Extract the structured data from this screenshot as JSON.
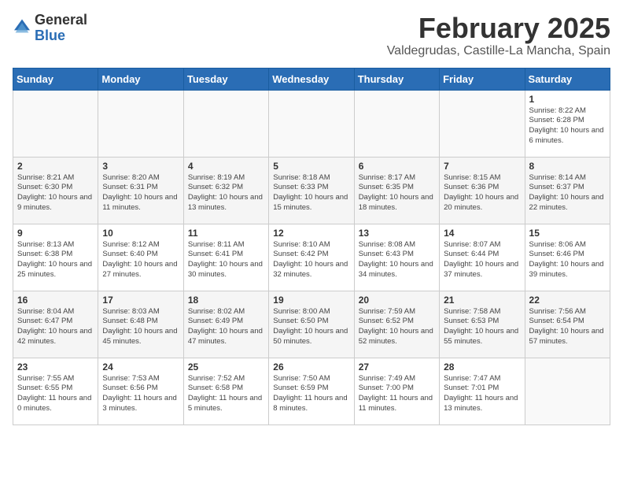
{
  "header": {
    "logo_general": "General",
    "logo_blue": "Blue",
    "month": "February 2025",
    "location": "Valdegrudas, Castille-La Mancha, Spain"
  },
  "days_of_week": [
    "Sunday",
    "Monday",
    "Tuesday",
    "Wednesday",
    "Thursday",
    "Friday",
    "Saturday"
  ],
  "weeks": [
    [
      {
        "day": "",
        "info": ""
      },
      {
        "day": "",
        "info": ""
      },
      {
        "day": "",
        "info": ""
      },
      {
        "day": "",
        "info": ""
      },
      {
        "day": "",
        "info": ""
      },
      {
        "day": "",
        "info": ""
      },
      {
        "day": "1",
        "info": "Sunrise: 8:22 AM\nSunset: 6:28 PM\nDaylight: 10 hours\nand 6 minutes."
      }
    ],
    [
      {
        "day": "2",
        "info": "Sunrise: 8:21 AM\nSunset: 6:30 PM\nDaylight: 10 hours\nand 9 minutes."
      },
      {
        "day": "3",
        "info": "Sunrise: 8:20 AM\nSunset: 6:31 PM\nDaylight: 10 hours\nand 11 minutes."
      },
      {
        "day": "4",
        "info": "Sunrise: 8:19 AM\nSunset: 6:32 PM\nDaylight: 10 hours\nand 13 minutes."
      },
      {
        "day": "5",
        "info": "Sunrise: 8:18 AM\nSunset: 6:33 PM\nDaylight: 10 hours\nand 15 minutes."
      },
      {
        "day": "6",
        "info": "Sunrise: 8:17 AM\nSunset: 6:35 PM\nDaylight: 10 hours\nand 18 minutes."
      },
      {
        "day": "7",
        "info": "Sunrise: 8:15 AM\nSunset: 6:36 PM\nDaylight: 10 hours\nand 20 minutes."
      },
      {
        "day": "8",
        "info": "Sunrise: 8:14 AM\nSunset: 6:37 PM\nDaylight: 10 hours\nand 22 minutes."
      }
    ],
    [
      {
        "day": "9",
        "info": "Sunrise: 8:13 AM\nSunset: 6:38 PM\nDaylight: 10 hours\nand 25 minutes."
      },
      {
        "day": "10",
        "info": "Sunrise: 8:12 AM\nSunset: 6:40 PM\nDaylight: 10 hours\nand 27 minutes."
      },
      {
        "day": "11",
        "info": "Sunrise: 8:11 AM\nSunset: 6:41 PM\nDaylight: 10 hours\nand 30 minutes."
      },
      {
        "day": "12",
        "info": "Sunrise: 8:10 AM\nSunset: 6:42 PM\nDaylight: 10 hours\nand 32 minutes."
      },
      {
        "day": "13",
        "info": "Sunrise: 8:08 AM\nSunset: 6:43 PM\nDaylight: 10 hours\nand 34 minutes."
      },
      {
        "day": "14",
        "info": "Sunrise: 8:07 AM\nSunset: 6:44 PM\nDaylight: 10 hours\nand 37 minutes."
      },
      {
        "day": "15",
        "info": "Sunrise: 8:06 AM\nSunset: 6:46 PM\nDaylight: 10 hours\nand 39 minutes."
      }
    ],
    [
      {
        "day": "16",
        "info": "Sunrise: 8:04 AM\nSunset: 6:47 PM\nDaylight: 10 hours\nand 42 minutes."
      },
      {
        "day": "17",
        "info": "Sunrise: 8:03 AM\nSunset: 6:48 PM\nDaylight: 10 hours\nand 45 minutes."
      },
      {
        "day": "18",
        "info": "Sunrise: 8:02 AM\nSunset: 6:49 PM\nDaylight: 10 hours\nand 47 minutes."
      },
      {
        "day": "19",
        "info": "Sunrise: 8:00 AM\nSunset: 6:50 PM\nDaylight: 10 hours\nand 50 minutes."
      },
      {
        "day": "20",
        "info": "Sunrise: 7:59 AM\nSunset: 6:52 PM\nDaylight: 10 hours\nand 52 minutes."
      },
      {
        "day": "21",
        "info": "Sunrise: 7:58 AM\nSunset: 6:53 PM\nDaylight: 10 hours\nand 55 minutes."
      },
      {
        "day": "22",
        "info": "Sunrise: 7:56 AM\nSunset: 6:54 PM\nDaylight: 10 hours\nand 57 minutes."
      }
    ],
    [
      {
        "day": "23",
        "info": "Sunrise: 7:55 AM\nSunset: 6:55 PM\nDaylight: 11 hours\nand 0 minutes."
      },
      {
        "day": "24",
        "info": "Sunrise: 7:53 AM\nSunset: 6:56 PM\nDaylight: 11 hours\nand 3 minutes."
      },
      {
        "day": "25",
        "info": "Sunrise: 7:52 AM\nSunset: 6:58 PM\nDaylight: 11 hours\nand 5 minutes."
      },
      {
        "day": "26",
        "info": "Sunrise: 7:50 AM\nSunset: 6:59 PM\nDaylight: 11 hours\nand 8 minutes."
      },
      {
        "day": "27",
        "info": "Sunrise: 7:49 AM\nSunset: 7:00 PM\nDaylight: 11 hours\nand 11 minutes."
      },
      {
        "day": "28",
        "info": "Sunrise: 7:47 AM\nSunset: 7:01 PM\nDaylight: 11 hours\nand 13 minutes."
      },
      {
        "day": "",
        "info": ""
      }
    ]
  ]
}
